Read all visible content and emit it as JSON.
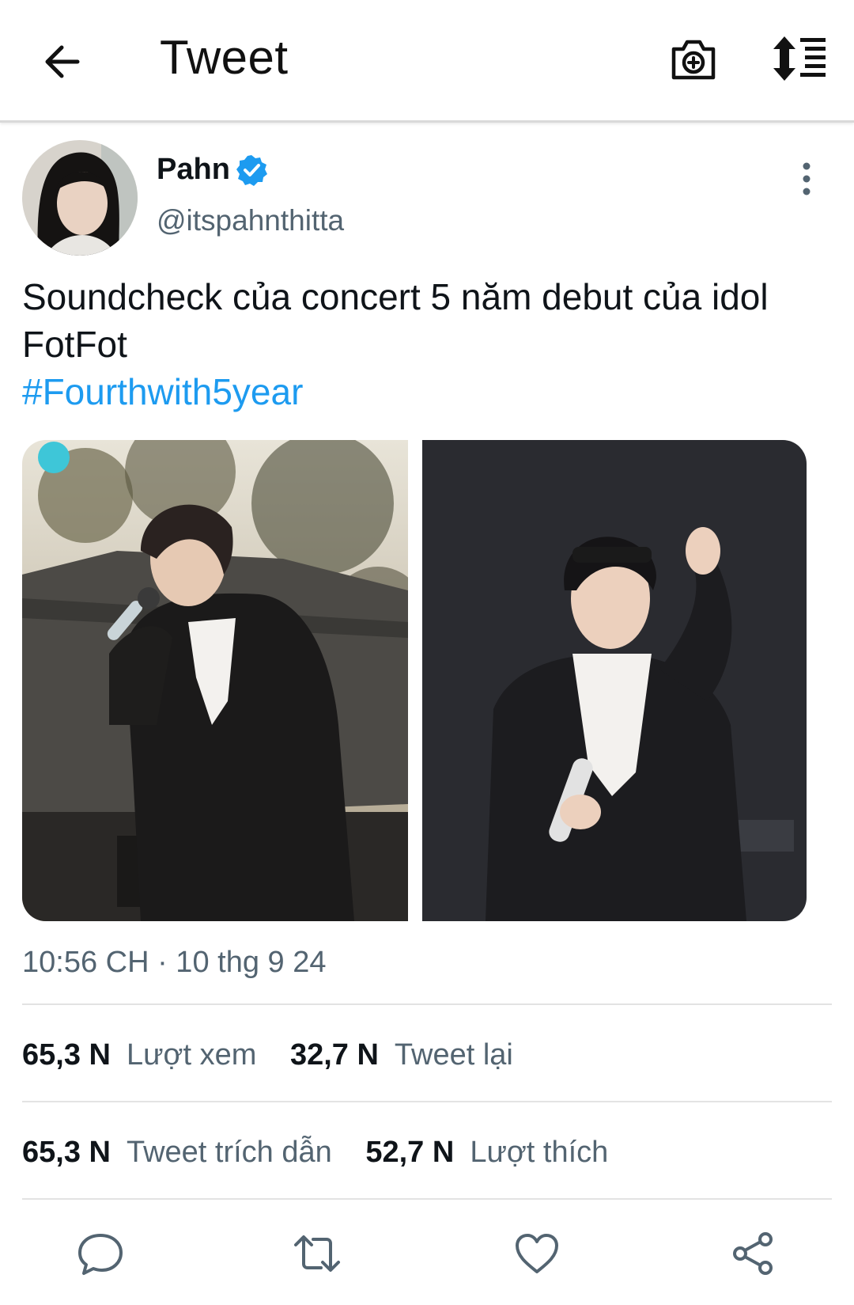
{
  "header": {
    "title": "Tweet"
  },
  "author": {
    "display_name": "Pahn",
    "handle": "@itspahnthitta",
    "verified": true
  },
  "tweet": {
    "text_line1": "Soundcheck của concert 5 năm debut của idol",
    "text_line2": "FotFot",
    "hashtag": "#Fourthwith5year",
    "timestamp": "10:56 CH · 10 thg 9 24",
    "media_count": 2
  },
  "stats": {
    "views_value": "65,3 N",
    "views_label": "Lượt xem",
    "retweets_value": "32,7 N",
    "retweets_label": "Tweet lại",
    "quotes_value": "65,3 N",
    "quotes_label": "Tweet trích dẫn",
    "likes_value": "52,7 N",
    "likes_label": "Lượt thích"
  },
  "colors": {
    "accent": "#1d9bf0",
    "text_primary": "#0f1419",
    "text_secondary": "#536471",
    "icon": "#536471"
  },
  "icons": [
    "arrow-left-icon",
    "camera-plus-icon",
    "sort-icon",
    "verified-badge-icon",
    "more-vertical-icon",
    "reply-icon",
    "retweet-icon",
    "like-icon",
    "share-icon"
  ]
}
